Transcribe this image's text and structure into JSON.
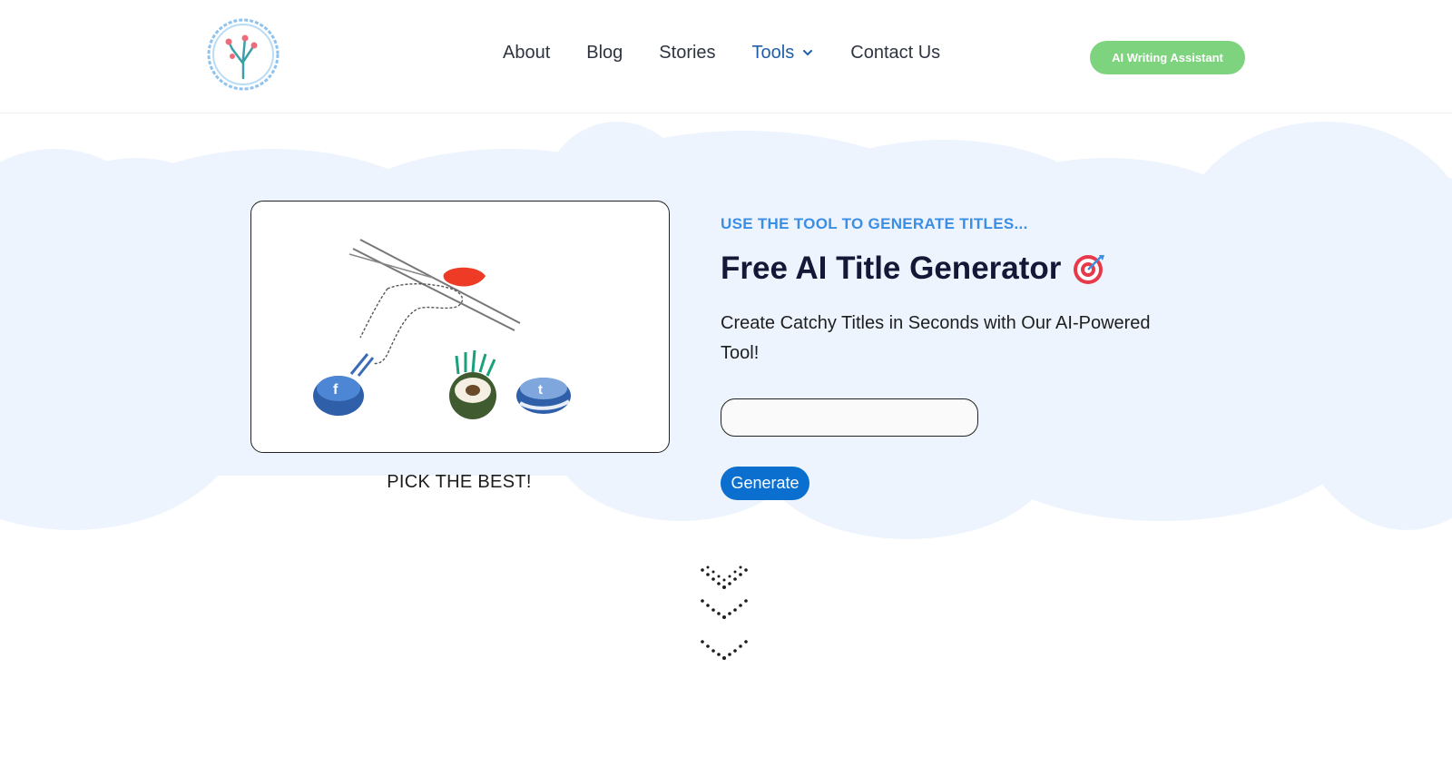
{
  "header": {
    "logo_icon": "branching-tree-logo",
    "nav": [
      {
        "label": "About"
      },
      {
        "label": "Blog"
      },
      {
        "label": "Stories"
      },
      {
        "label": "Tools",
        "has_dropdown": true
      },
      {
        "label": "Contact Us"
      }
    ],
    "cta_label": "AI Writing Assistant",
    "cta_color": "#7ed37e",
    "active_nav_color": "#1f5fa8"
  },
  "hero": {
    "illustration": "chopsticks-picking-social-media-sushi",
    "caption": "PICK THE BEST!",
    "eyebrow": "USE THE TOOL TO GENERATE TITLES...",
    "title": "Free AI Title Generator",
    "title_icon": "target-bullseye-icon",
    "subtitle": "Create Catchy Titles in Seconds with Our AI-Powered Tool!",
    "input_value": "",
    "generate_label": "Generate",
    "accent_color": "#3a8ee6",
    "button_color": "#0b6fd0"
  },
  "scroll_indicator_icon": "down-chevrons-icon"
}
